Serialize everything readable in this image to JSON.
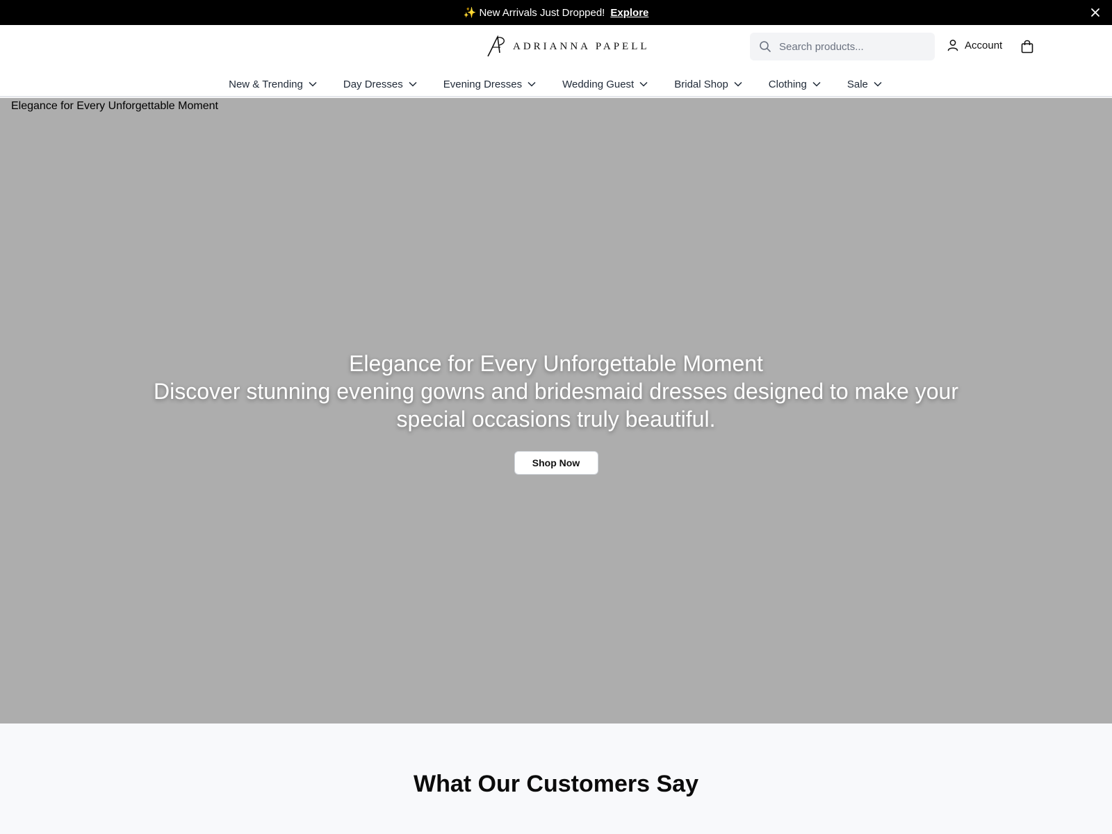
{
  "announcement": {
    "sparkle": "✨",
    "message": "New Arrivals Just Dropped!",
    "link_label": "Explore"
  },
  "header": {
    "logo_text": "ADRIANNA PAPELL",
    "search_placeholder": "Search products...",
    "account_label": "Account"
  },
  "nav": {
    "items": [
      {
        "label": "New & Trending"
      },
      {
        "label": "Day Dresses"
      },
      {
        "label": "Evening Dresses"
      },
      {
        "label": "Wedding Guest"
      },
      {
        "label": "Bridal Shop"
      },
      {
        "label": "Clothing"
      },
      {
        "label": "Sale"
      }
    ]
  },
  "hero": {
    "image_alt": "Elegance for Every Unforgettable Moment",
    "title": "Elegance for Every Unforgettable Moment",
    "subtitle": "Discover stunning evening gowns and bridesmaid dresses designed to make your special occasions truly beautiful.",
    "cta_label": "Shop Now",
    "background_color": "#adadad"
  },
  "testimonials": {
    "heading": "What Our Customers Say"
  },
  "colors": {
    "announcement_bg": "#000000",
    "search_bg": "#f3f4f6",
    "section_bg": "#f8f9fb"
  }
}
